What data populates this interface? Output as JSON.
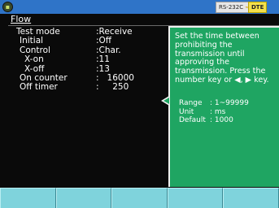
{
  "status_bar": {
    "interface_label": "RS-232C",
    "mode_label": "DTE"
  },
  "page_title": "Flow",
  "settings": [
    {
      "label": "Test mode",
      "value": ":Receive",
      "level": 0
    },
    {
      "label": "Initial",
      "value": ":Off",
      "level": 1
    },
    {
      "label": "Control",
      "value": ":Char.",
      "level": 1
    },
    {
      "label": "X-on",
      "value": ":11",
      "level": 2
    },
    {
      "label": "X-off",
      "value": ":13",
      "level": 2
    },
    {
      "label": "On counter",
      "value": ":   16000",
      "level": 1
    },
    {
      "label": "Off timer",
      "value": ":     250",
      "level": 1
    }
  ],
  "help": {
    "text": "Set the time between prohibiting the transmission until approving the transmission. Press the number key or ◀, ▶ key.",
    "range_label": "Range",
    "range_value": ": 1~99999",
    "unit_label": "Unit",
    "unit_value": ": ms",
    "default_label": "Default",
    "default_value": ": 1000"
  },
  "softkeys": [
    "",
    "",
    "",
    "",
    ""
  ]
}
